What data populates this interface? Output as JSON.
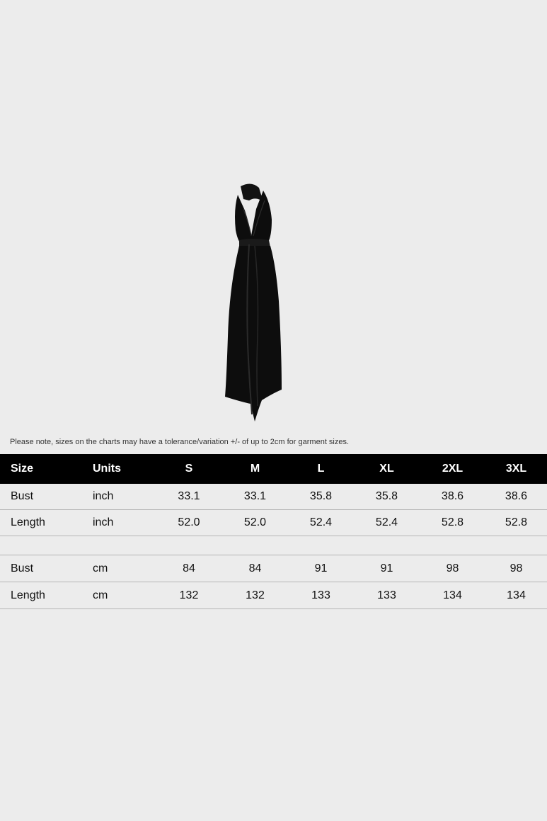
{
  "product": {
    "image_alt": "black halter maxi dress"
  },
  "note": "Please note, sizes on the charts may have a tolerance/variation +/- of up to 2cm for garment sizes.",
  "table": {
    "headers": [
      "Size",
      "Units",
      "S",
      "M",
      "L",
      "XL",
      "2XL",
      "3XL"
    ],
    "inch_rows": [
      {
        "label": "Bust",
        "unit": "inch",
        "values": [
          "33.1",
          "33.1",
          "35.8",
          "35.8",
          "38.6",
          "38.6"
        ]
      },
      {
        "label": "Length",
        "unit": "inch",
        "values": [
          "52.0",
          "52.0",
          "52.4",
          "52.4",
          "52.8",
          "52.8"
        ]
      }
    ],
    "cm_rows": [
      {
        "label": "Bust",
        "unit": "cm",
        "values": [
          "84",
          "84",
          "91",
          "91",
          "98",
          "98"
        ]
      },
      {
        "label": "Length",
        "unit": "cm",
        "values": [
          "132",
          "132",
          "133",
          "133",
          "134",
          "134"
        ]
      }
    ]
  },
  "colors": {
    "background": "#ececec",
    "header_bg": "#000000",
    "header_text": "#ffffff",
    "dress": "#0d0d0d"
  }
}
